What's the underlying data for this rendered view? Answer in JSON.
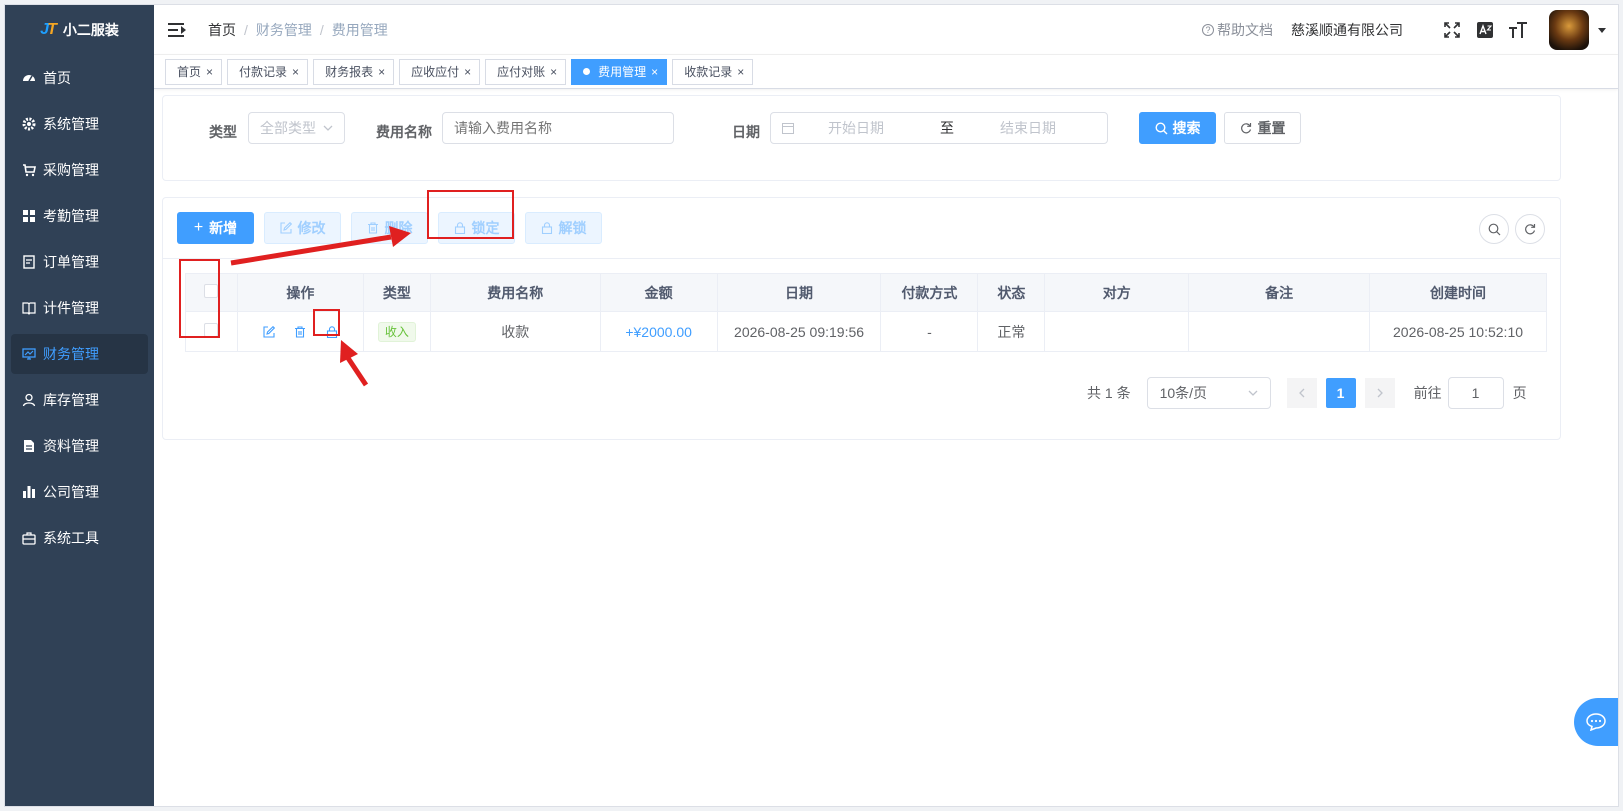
{
  "app": {
    "logo_mark": "JT",
    "name": "小二服装"
  },
  "sidebar": {
    "items": [
      {
        "label": "首页",
        "icon": "dashboard-icon"
      },
      {
        "label": "系统管理",
        "icon": "gear-icon"
      },
      {
        "label": "采购管理",
        "icon": "cart-icon"
      },
      {
        "label": "考勤管理",
        "icon": "grid-icon"
      },
      {
        "label": "订单管理",
        "icon": "order-icon"
      },
      {
        "label": "计件管理",
        "icon": "book-icon"
      },
      {
        "label": "财务管理",
        "icon": "monitor-icon",
        "active": true
      },
      {
        "label": "库存管理",
        "icon": "user-icon"
      },
      {
        "label": "资料管理",
        "icon": "document-icon"
      },
      {
        "label": "公司管理",
        "icon": "bar-chart-icon"
      },
      {
        "label": "系统工具",
        "icon": "toolbox-icon"
      }
    ]
  },
  "header": {
    "breadcrumb": [
      "首页",
      "财务管理",
      "费用管理"
    ],
    "help_label": "帮助文档",
    "company": "慈溪顺通有限公司"
  },
  "tags": [
    {
      "label": "首页"
    },
    {
      "label": "付款记录"
    },
    {
      "label": "财务报表"
    },
    {
      "label": "应收应付"
    },
    {
      "label": "应付对账"
    },
    {
      "label": "费用管理",
      "active": true
    },
    {
      "label": "收款记录"
    }
  ],
  "search": {
    "type_label": "类型",
    "type_value": "全部类型",
    "name_label": "费用名称",
    "name_placeholder": "请输入费用名称",
    "date_label": "日期",
    "start_placeholder": "开始日期",
    "range_sep": "至",
    "end_placeholder": "结束日期",
    "search_btn": "搜索",
    "reset_btn": "重置"
  },
  "toolbar": {
    "add": "新增",
    "edit": "修改",
    "delete": "删除",
    "lock": "锁定",
    "unlock": "解锁"
  },
  "table": {
    "columns": [
      "操作",
      "类型",
      "费用名称",
      "金额",
      "日期",
      "付款方式",
      "状态",
      "对方",
      "备注",
      "创建时间"
    ],
    "rows": [
      {
        "type": "收入",
        "name": "收款",
        "amount": "+¥2000.00",
        "date": "2026-08-25 09:19:56",
        "pay_method": "-",
        "status": "正常",
        "counterparty": "",
        "remark": "",
        "created": "2026-08-25 10:52:10"
      }
    ]
  },
  "pagination": {
    "total": "共 1 条",
    "page_size": "10条/页",
    "current": "1",
    "goto_label": "前往",
    "goto_value": "1",
    "page_suffix": "页"
  },
  "colors": {
    "primary": "#409eff",
    "sidebar_bg": "#304156",
    "annotation": "#e02020",
    "income": "#67c23a"
  }
}
